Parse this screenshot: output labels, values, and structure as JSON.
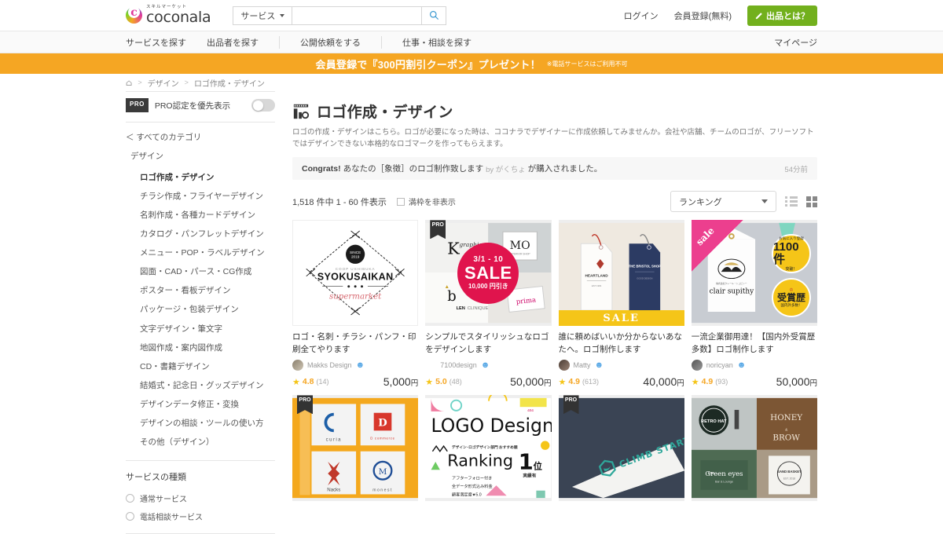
{
  "header": {
    "logo_kana": "スキルマーケット",
    "logo_name": "coconala",
    "search_category": "サービス",
    "search_value": "",
    "search_placeholder": "",
    "login": "ログイン",
    "register": "会員登録(無料)",
    "pro_button": "出品とは？"
  },
  "nav": {
    "items": [
      {
        "label": "サービスを探す"
      },
      {
        "label": "出品者を探す"
      },
      {
        "label": "公開依頼をする"
      },
      {
        "label": "仕事・相談を探す"
      }
    ],
    "mypage": "マイページ"
  },
  "banner": {
    "main": "会員登録で『300円割引クーポン』プレゼント！",
    "sub": "※電話サービスはご利用不可"
  },
  "breadcrumb": {
    "home_icon": "home-icon",
    "items": [
      {
        "label": "デザイン"
      },
      {
        "label": "ロゴ作成・デザイン"
      }
    ]
  },
  "sidebar": {
    "pro_badge": "PRO",
    "pro_toggle_label": "PRO認定を優先表示",
    "pro_toggle_state": "off",
    "all_categories": "＜ すべてのカテゴリ",
    "parent_category": "デザイン",
    "categories": [
      {
        "label": "ロゴ作成・デザイン",
        "active": true
      },
      {
        "label": "チラシ作成・フライヤーデザイン",
        "active": false
      },
      {
        "label": "名刺作成・各種カードデザイン",
        "active": false
      },
      {
        "label": "カタログ・パンフレットデザイン",
        "active": false
      },
      {
        "label": "メニュー・POP・ラベルデザイン",
        "active": false
      },
      {
        "label": "図面・CAD・パース・CG作成",
        "active": false
      },
      {
        "label": "ポスター・看板デザイン",
        "active": false
      },
      {
        "label": "パッケージ・包装デザイン",
        "active": false
      },
      {
        "label": "文字デザイン・筆文字",
        "active": false
      },
      {
        "label": "地図作成・案内図作成",
        "active": false
      },
      {
        "label": "CD・書籍デザイン",
        "active": false
      },
      {
        "label": "結婚式・記念日・グッズデザイン",
        "active": false
      },
      {
        "label": "デザインデータ修正・変換",
        "active": false
      },
      {
        "label": "デザインの相談・ツールの使い方",
        "active": false
      },
      {
        "label": "その他（デザイン）",
        "active": false
      }
    ],
    "service_type_title": "サービスの種類",
    "service_types": [
      {
        "label": "通常サービス"
      },
      {
        "label": "電話相談サービス"
      }
    ]
  },
  "main": {
    "title": "ロゴ作成・デザイン",
    "title_icon": "logo-design-icon",
    "description": "ロゴの作成・デザインはこちら。ロゴが必要になった時は、ココナラでデザイナーに作成依頼してみませんか。会社や店舗、チームのロゴが、フリーソフトではデザインできない本格的なロゴマークを作ってもらえます。",
    "congrats": {
      "prefix": "Congrats!",
      "text": "あなたの［象徴］のロゴ制作致します",
      "by": "by がくちょ",
      "suffix": "が購入されました。",
      "time": "54分前"
    },
    "result_count": "1,518 件中 1 - 60 件表示",
    "hide_full_label": "満枠を非表示",
    "hide_full_checked": false,
    "sort_selected": "ランキング",
    "view_mode": "grid"
  },
  "cards": [
    {
      "title": "ロゴ・名刺・チラシ・パンフ・印刷全てやります",
      "seller": "Makks Design",
      "rating": "4.8",
      "reviews": "(14)",
      "price": "5,000",
      "currency": "円",
      "pro": false,
      "thumb": {
        "type": "diamond-logo",
        "since": "SINCE 2019",
        "coop": "COOP USHIBUKA",
        "name": "SYOKUSAIKAN",
        "sub": "supermarket"
      }
    },
    {
      "title": "シンプルでスタイリッシュなロゴをデザインします",
      "seller": "7100design",
      "rating": "5.0",
      "reviews": "(48)",
      "price": "50,000",
      "currency": "円",
      "pro": true,
      "thumb": {
        "type": "sale-collage",
        "sale_dates": "3/1 - 10",
        "sale_word": "SALE",
        "sale_amount": "10,000 円引き",
        "tile1": "K graphic",
        "tile2": "MO",
        "tile3": "LEN CLINIQUE",
        "tile4": "prima"
      }
    },
    {
      "title": "誰に頼めばいいか分からないあなたへ。ロゴ制作します",
      "seller": "Matty",
      "rating": "4.9",
      "reviews": "(613)",
      "price": "40,000",
      "currency": "円",
      "pro": false,
      "thumb": {
        "type": "tags",
        "tag1": "HEARTLAND",
        "tag2": "THE BRISTOL SHOP",
        "sale_bar": "SALE"
      }
    },
    {
      "title": "一流企業御用達！【国内外受賞歴多数】ロゴ制作します",
      "seller": "noricyan",
      "rating": "4.9",
      "reviews": "(93)",
      "price": "50,000",
      "currency": "円",
      "pro": false,
      "thumb": {
        "type": "sale-tag",
        "corner": "sale",
        "brand": "clair supithy",
        "badge1_top": "お気に入り登録",
        "badge1_main": "1100件",
        "badge1_sub": "突破！",
        "badge2_main": "受賞歴",
        "badge2_sub": "国内外多数！"
      }
    },
    {
      "title": "",
      "seller": "",
      "rating": "",
      "reviews": "",
      "price": "",
      "currency": "",
      "pro": true,
      "thumb": {
        "type": "logo-grid",
        "l1": "curia",
        "l2": "D commerce",
        "l3": "Nacks",
        "l4": "monest"
      }
    },
    {
      "title": "",
      "seller": "",
      "rating": "",
      "reviews": "",
      "price": "",
      "currency": "",
      "pro": false,
      "thumb": {
        "type": "ranking",
        "head": "LOGO Design",
        "sub_small": "デザイン・ロゴデザイン部門 おすすめ順",
        "rank_word": "Ranking",
        "rank_num": "1位",
        "rank_note": "実績有",
        "b1": "アフターフォロー付き",
        "b2": "全データ形式込み料金",
        "b3": "顧客満足度★5.0"
      }
    },
    {
      "title": "",
      "seller": "",
      "rating": "",
      "reviews": "",
      "price": "",
      "currency": "",
      "pro": true,
      "thumb": {
        "type": "climb",
        "brand": "CLIMB START"
      }
    },
    {
      "title": "",
      "seller": "",
      "rating": "",
      "reviews": "",
      "price": "",
      "currency": "",
      "pro": false,
      "thumb": {
        "type": "signage",
        "s1": "RETRO HAT",
        "s2": "HONEY & BROW",
        "s3": "576 Green eyes",
        "s4": "SAND BASKET"
      }
    }
  ],
  "colors": {
    "accent_orange": "#f5a623",
    "brand_green": "#72b01d",
    "sale_pink": "#e0144d",
    "star_yellow": "#f5c518"
  }
}
